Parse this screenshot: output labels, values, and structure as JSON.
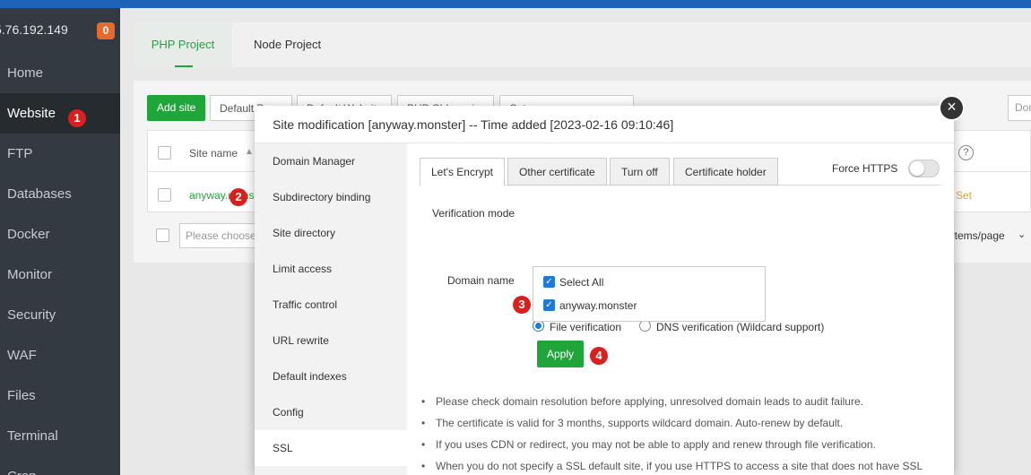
{
  "sidebar": {
    "server_ip": "5.76.192.149",
    "badge": "0",
    "items": [
      {
        "label": "Home"
      },
      {
        "label": "Website"
      },
      {
        "label": "FTP"
      },
      {
        "label": "Databases"
      },
      {
        "label": "Docker"
      },
      {
        "label": "Monitor"
      },
      {
        "label": "Security"
      },
      {
        "label": "WAF"
      },
      {
        "label": "Files"
      },
      {
        "label": "Terminal"
      },
      {
        "label": "Cron"
      }
    ]
  },
  "steps": [
    "1",
    "2",
    "3",
    "4"
  ],
  "project_tabs": [
    "PHP Project",
    "Node Project"
  ],
  "website": {
    "add_site": "Add site",
    "toolbar": [
      "Default Page",
      "Default Website",
      "PHP CLI version",
      "Category manager"
    ],
    "search_placeholder": "Dom",
    "site_name_header": "Site name",
    "site_row_name": "anyway.monster",
    "row_action": "Set",
    "bottom_placeholder": "Please choose",
    "per_page": "items/page"
  },
  "modal": {
    "title": "Site modification [anyway.monster] -- Time added [2023-02-16 09:10:46]",
    "close": "×",
    "nav": [
      "Domain Manager",
      "Subdirectory binding",
      "Site directory",
      "Limit access",
      "Traffic control",
      "URL rewrite",
      "Default indexes",
      "Config",
      "SSL"
    ],
    "ssl_tabs": [
      "Let's Encrypt",
      "Other certificate",
      "Turn off",
      "Certificate holder"
    ],
    "force_https": "Force HTTPS",
    "verification_mode_label": "Verification mode",
    "file_verification": "File verification",
    "dns_verification": "DNS verification (Wildcard support)",
    "domain_name_label": "Domain name",
    "select_all": "Select All",
    "domain": "anyway.monster",
    "apply": "Apply",
    "notes": [
      "Please check domain resolution before applying, unresolved domain leads to audit failure.",
      "The certificate is valid for 3 months, supports wildcard domain. Auto-renew by default.",
      "If you uses CDN or redirect, you may not be able to apply and renew through file verification.",
      "When you do not specify a SSL default site, if you use HTTPS to access a site that does not have SSL"
    ]
  },
  "colors": {
    "accent_green": "#20a53a",
    "sidebar_bg": "#333a41",
    "step_red": "#d8201e",
    "top_bar": "#1e63b8"
  }
}
